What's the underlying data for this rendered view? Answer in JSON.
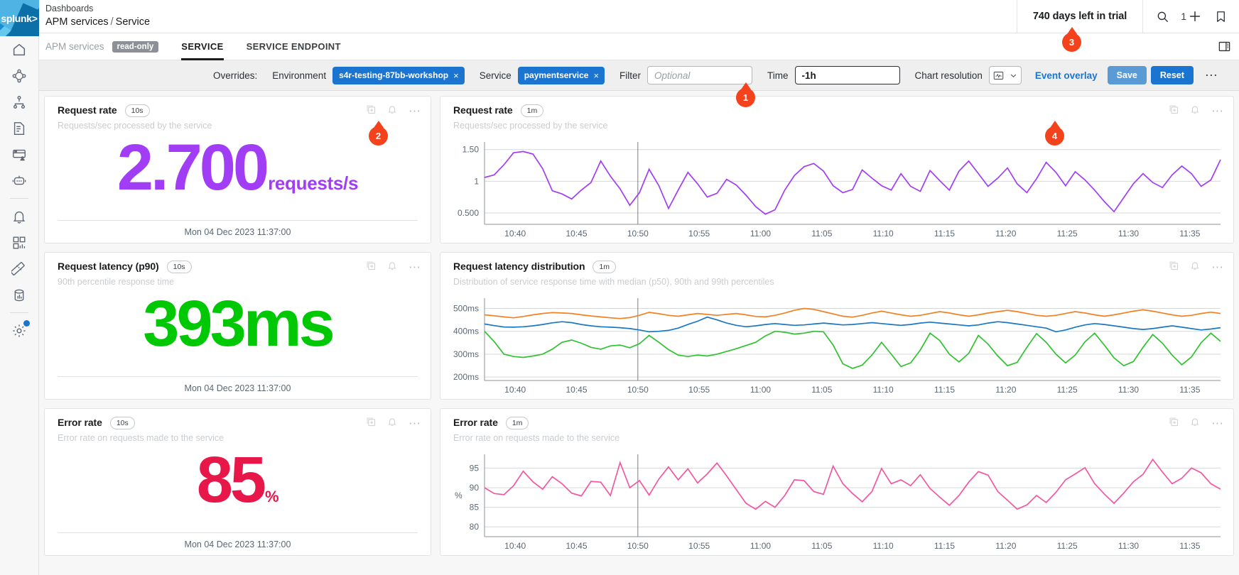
{
  "brand": {
    "logo_text": "splunk>"
  },
  "header": {
    "breadcrumb_top": "Dashboards",
    "breadcrumb_section": "APM services",
    "breadcrumb_sep": "/",
    "breadcrumb_page": "Service",
    "trial": "740 days left in trial",
    "plus_count": "1"
  },
  "rail": {
    "items": [
      {
        "name": "home-icon",
        "label": "Home"
      },
      {
        "name": "service-map-icon",
        "label": "Service map"
      },
      {
        "name": "hierarchy-icon",
        "label": "Hierarchy"
      },
      {
        "name": "log-observer-icon",
        "label": "Log observer"
      },
      {
        "name": "rum-icon",
        "label": "RUM"
      },
      {
        "name": "synthetics-robot-icon",
        "label": "Synthetics"
      },
      {
        "name": "alerts-bell-icon",
        "label": "Alerts"
      },
      {
        "name": "dashboards-icon",
        "label": "Dashboards"
      },
      {
        "name": "metrics-ruler-icon",
        "label": "Metrics"
      },
      {
        "name": "data-management-icon",
        "label": "Data management"
      },
      {
        "name": "settings-gear-icon",
        "label": "Settings"
      }
    ]
  },
  "tabbar": {
    "context": "APM services",
    "read_only": "read-only",
    "tabs": [
      {
        "label": "SERVICE",
        "active": true
      },
      {
        "label": "SERVICE ENDPOINT",
        "active": false
      }
    ]
  },
  "overrides": {
    "title": "Overrides:",
    "environment_label": "Environment",
    "environment_chip": "s4r-testing-87bb-workshop",
    "service_label": "Service",
    "service_chip": "paymentservice",
    "filter_label": "Filter",
    "filter_placeholder": "Optional",
    "filter_value": "",
    "time_label": "Time",
    "time_value": "-1h",
    "chart_resolution_label": "Chart resolution",
    "event_overlay": "Event overlay",
    "save": "Save",
    "reset": "Reset",
    "chip_close": "×"
  },
  "callouts": [
    {
      "id": "1",
      "label": "1"
    },
    {
      "id": "2",
      "label": "2"
    },
    {
      "id": "3",
      "label": "3"
    },
    {
      "id": "4",
      "label": "4"
    }
  ],
  "panels": {
    "request_rate_value": {
      "title": "Request rate",
      "resolution": "10s",
      "subtitle": "Requests/sec processed by the service",
      "value": "2.700",
      "unit": "requests/s",
      "color": "#a13df5",
      "timestamp": "Mon 04 Dec 2023 11:37:00"
    },
    "request_latency_value": {
      "title": "Request latency (p90)",
      "resolution": "10s",
      "subtitle": "90th percentile response time",
      "value": "393",
      "unit": "ms",
      "color": "#00c805",
      "timestamp": "Mon 04 Dec 2023 11:37:00"
    },
    "error_rate_value": {
      "title": "Error rate",
      "resolution": "10s",
      "subtitle": "Error rate on requests made to the service",
      "value": "85",
      "unit": "%",
      "color": "#e8174a",
      "timestamp": "Mon 04 Dec 2023 11:37:00"
    },
    "request_rate_chart": {
      "title": "Request rate",
      "resolution": "1m",
      "subtitle": "Requests/sec processed by the service"
    },
    "latency_dist_chart": {
      "title": "Request latency distribution",
      "resolution": "1m",
      "subtitle": "Distribution of service response time with median (p50), 90th and 99th percentiles"
    },
    "error_rate_chart": {
      "title": "Error rate",
      "resolution": "1m",
      "subtitle": "Error rate on requests made to the service"
    }
  },
  "chart_data": [
    {
      "id": "request_rate_chart",
      "type": "line",
      "title": "Request rate",
      "subtitle": "Requests/sec processed by the service",
      "xlabel": "",
      "ylabel": "",
      "ytick_labels": [
        "0.500",
        "1",
        "1.50"
      ],
      "ytick_values": [
        0.5,
        1.0,
        1.5
      ],
      "ylim": [
        0.32,
        1.62
      ],
      "xtick_labels": [
        "10:40",
        "10:45",
        "10:50",
        "10:55",
        "11:00",
        "11:05",
        "11:10",
        "11:15",
        "11:20",
        "11:25",
        "11:30",
        "11:35"
      ],
      "grid": true,
      "legend": "none",
      "cursor_x_label": "10:50",
      "series": [
        {
          "name": "requests/s",
          "color": "#a13df5",
          "values": [
            1.06,
            1.1,
            1.26,
            1.45,
            1.47,
            1.43,
            1.2,
            0.85,
            0.8,
            0.72,
            0.86,
            0.98,
            1.32,
            1.08,
            0.88,
            0.62,
            0.82,
            1.19,
            0.93,
            0.57,
            0.86,
            1.14,
            0.96,
            0.75,
            0.81,
            1.03,
            0.94,
            0.78,
            0.6,
            0.48,
            0.55,
            0.86,
            1.09,
            1.23,
            1.28,
            1.16,
            0.93,
            0.82,
            0.87,
            1.18,
            1.05,
            0.93,
            0.86,
            1.12,
            0.92,
            0.84,
            1.17,
            1.01,
            0.86,
            1.16,
            1.32,
            1.12,
            0.92,
            1.05,
            1.21,
            0.96,
            0.82,
            1.04,
            1.3,
            1.14,
            0.93,
            1.15,
            1.02,
            0.86,
            0.68,
            0.52,
            0.74,
            0.96,
            1.12,
            0.98,
            0.9,
            1.1,
            1.24,
            1.12,
            0.92,
            1.02,
            1.34
          ]
        }
      ]
    },
    {
      "id": "latency_dist_chart",
      "type": "line",
      "title": "Request latency distribution",
      "subtitle": "Distribution of service response time with median (p50), 90th and 99th percentiles",
      "xlabel": "",
      "ylabel": "",
      "ytick_labels": [
        "200ms",
        "300ms",
        "400ms",
        "500ms"
      ],
      "ytick_values": [
        200,
        300,
        400,
        500
      ],
      "ylim": [
        185,
        545
      ],
      "xtick_labels": [
        "10:40",
        "10:45",
        "10:50",
        "10:55",
        "11:00",
        "11:05",
        "11:10",
        "11:15",
        "11:20",
        "11:25",
        "11:30",
        "11:35"
      ],
      "grid": true,
      "legend": "none",
      "cursor_x_label": "10:50",
      "series": [
        {
          "name": "p99",
          "color": "#f28023",
          "values": [
            472,
            468,
            463,
            459,
            465,
            472,
            478,
            482,
            480,
            478,
            472,
            467,
            463,
            459,
            456,
            460,
            470,
            483,
            477,
            470,
            466,
            472,
            478,
            474,
            470,
            474,
            478,
            472,
            465,
            463,
            470,
            480,
            492,
            500,
            496,
            486,
            476,
            466,
            462,
            470,
            480,
            488,
            480,
            472,
            466,
            470,
            478,
            486,
            480,
            472,
            466,
            472,
            480,
            486,
            492,
            486,
            478,
            470,
            466,
            470,
            478,
            486,
            480,
            472,
            466,
            472,
            480,
            488,
            494,
            488,
            480,
            472,
            466,
            470,
            478,
            484,
            478
          ]
        },
        {
          "name": "p90",
          "color": "#1878c4",
          "values": [
            432,
            425,
            419,
            418,
            420,
            424,
            430,
            437,
            442,
            438,
            430,
            424,
            420,
            418,
            416,
            412,
            406,
            398,
            400,
            404,
            414,
            430,
            444,
            462,
            450,
            436,
            426,
            420,
            424,
            430,
            434,
            430,
            426,
            428,
            432,
            436,
            432,
            428,
            430,
            434,
            438,
            434,
            430,
            426,
            430,
            436,
            440,
            436,
            432,
            428,
            424,
            428,
            436,
            442,
            438,
            432,
            426,
            420,
            414,
            398,
            406,
            418,
            428,
            434,
            430,
            424,
            418,
            412,
            408,
            412,
            418,
            424,
            418,
            412,
            406,
            410,
            416
          ]
        },
        {
          "name": "p50",
          "color": "#2fc22f",
          "values": [
            400,
            355,
            300,
            290,
            286,
            292,
            300,
            322,
            352,
            362,
            348,
            330,
            322,
            336,
            340,
            328,
            346,
            382,
            352,
            320,
            296,
            290,
            296,
            292,
            300,
            312,
            324,
            338,
            352,
            380,
            400,
            396,
            388,
            392,
            400,
            398,
            340,
            258,
            238,
            252,
            296,
            352,
            300,
            246,
            262,
            318,
            392,
            360,
            300,
            266,
            304,
            382,
            344,
            292,
            250,
            264,
            330,
            390,
            352,
            300,
            262,
            296,
            354,
            392,
            340,
            284,
            250,
            268,
            330,
            386,
            348,
            296,
            254,
            288,
            350,
            392,
            356
          ]
        }
      ]
    },
    {
      "id": "error_rate_chart",
      "type": "line",
      "title": "Error rate",
      "subtitle": "Error rate on requests made to the service",
      "xlabel": "",
      "ylabel": "%",
      "ytick_labels": [
        "80",
        "85",
        "90",
        "95"
      ],
      "ytick_values": [
        80,
        85,
        90,
        95
      ],
      "ylim": [
        77.5,
        98.5
      ],
      "xtick_labels": [
        "10:40",
        "10:45",
        "10:50",
        "10:55",
        "11:00",
        "11:05",
        "11:10",
        "11:15",
        "11:20",
        "11:25",
        "11:30",
        "11:35"
      ],
      "grid": true,
      "legend": "none",
      "cursor_x_label": "10:50",
      "series": [
        {
          "name": "error %",
          "color": "#f2579f",
          "values": [
            90.0,
            88.5,
            88.2,
            90.5,
            94.2,
            91.5,
            89.6,
            92.8,
            91.0,
            88.6,
            87.9,
            91.6,
            91.4,
            88.0,
            96.4,
            90.0,
            91.8,
            88.1,
            92.2,
            95.3,
            92.0,
            94.8,
            91.2,
            93.5,
            96.3,
            93.0,
            89.5,
            86.0,
            84.5,
            86.5,
            85.0,
            88.0,
            92.0,
            91.8,
            89.0,
            88.3,
            95.5,
            91.0,
            88.5,
            86.4,
            89.0,
            94.9,
            91.0,
            92.0,
            90.5,
            93.3,
            89.8,
            87.6,
            85.5,
            88.0,
            91.4,
            94.1,
            93.2,
            89.0,
            86.8,
            84.5,
            85.6,
            88.0,
            86.2,
            88.8,
            92.0,
            93.5,
            95.1,
            91.0,
            88.4,
            86.0,
            88.6,
            91.5,
            93.4,
            97.2,
            94.0,
            91.0,
            92.4,
            95.0,
            93.8,
            91.0,
            89.6
          ]
        }
      ]
    }
  ]
}
